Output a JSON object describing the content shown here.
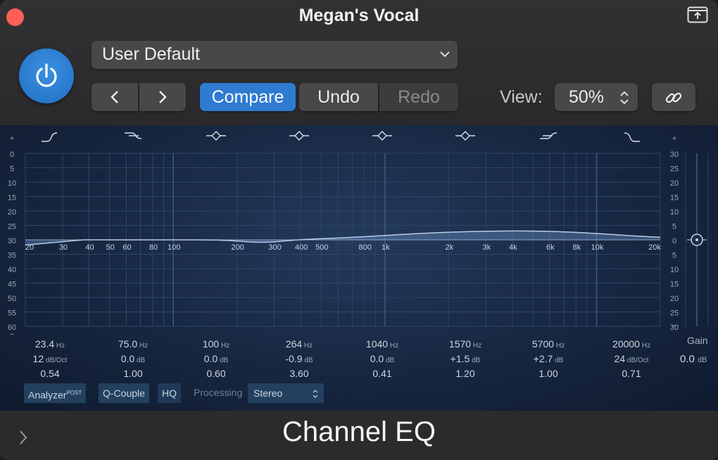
{
  "window": {
    "title": "Megan's Vocal",
    "footer_title": "Channel EQ"
  },
  "header": {
    "preset": "User Default",
    "compare_label": "Compare",
    "undo_label": "Undo",
    "redo_label": "Redo",
    "view_label": "View:",
    "view_value": "50%"
  },
  "eq": {
    "left_scale": [
      "+",
      "0",
      "5",
      "10",
      "15",
      "20",
      "25",
      "30",
      "35",
      "40",
      "45",
      "50",
      "55",
      "60",
      "–"
    ],
    "right_scale": [
      "+",
      "30",
      "25",
      "20",
      "15",
      "10",
      "5",
      "0",
      "5",
      "10",
      "15",
      "20",
      "25",
      "30",
      "–"
    ],
    "freq_labels": [
      "20",
      "30",
      "40",
      "50",
      "60",
      "80",
      "100",
      "200",
      "300",
      "400",
      "500",
      "800",
      "1k",
      "2k",
      "3k",
      "4k",
      "6k",
      "8k",
      "10k",
      "20k"
    ],
    "bands": [
      {
        "freq": "23.4",
        "freq_unit": "Hz",
        "gain": "12",
        "gain_unit": "dB/Oct",
        "q": "0.54"
      },
      {
        "freq": "75.0",
        "freq_unit": "Hz",
        "gain": "0.0",
        "gain_unit": "dB",
        "q": "1.00"
      },
      {
        "freq": "100",
        "freq_unit": "Hz",
        "gain": "0.0",
        "gain_unit": "dB",
        "q": "0.60"
      },
      {
        "freq": "264",
        "freq_unit": "Hz",
        "gain": "-0.9",
        "gain_unit": "dB",
        "q": "3.60"
      },
      {
        "freq": "1040",
        "freq_unit": "Hz",
        "gain": "0.0",
        "gain_unit": "dB",
        "q": "0.41"
      },
      {
        "freq": "1570",
        "freq_unit": "Hz",
        "gain": "+1.5",
        "gain_unit": "dB",
        "q": "1.20"
      },
      {
        "freq": "5700",
        "freq_unit": "Hz",
        "gain": "+2.7",
        "gain_unit": "dB",
        "q": "1.00"
      },
      {
        "freq": "20000",
        "freq_unit": "Hz",
        "gain": "24",
        "gain_unit": "dB/Oct",
        "q": "0.71"
      }
    ],
    "gain_label": "Gain",
    "gain_value": "0.0",
    "gain_unit": "dB",
    "analyzer_label": "Analyzer",
    "analyzer_sup": "POST",
    "qcouple_label": "Q-Couple",
    "hq_label": "HQ",
    "processing_label": "Processing",
    "processing_value": "Stereo"
  },
  "colors": {
    "accent": "#2e7bd1",
    "close": "#ff5f57",
    "graph_bg": "#172741",
    "curve": "#b8cbe6"
  }
}
